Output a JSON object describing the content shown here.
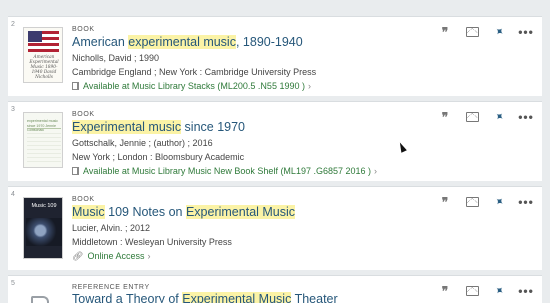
{
  "results": [
    {
      "index": "2",
      "type": "BOOK",
      "title_parts": [
        {
          "t": "American ",
          "hl": false
        },
        {
          "t": "experimental music",
          "hl": true
        },
        {
          "t": ", 1890-1940",
          "hl": false
        }
      ],
      "author_line": "Nicholls, David ; 1990",
      "publisher_line": "Cambridge England ; New York : Cambridge University Press",
      "availability_label": "Available at",
      "availability_location": "Music Library Stacks (ML200.5 .N55 1990 )",
      "cover_text": "American Experimental Music 1890-1940 David Nicholls"
    },
    {
      "index": "3",
      "type": "BOOK",
      "title_parts": [
        {
          "t": "Experimental music",
          "hl": true
        },
        {
          "t": " since 1970",
          "hl": false
        }
      ],
      "author_line": "Gottschalk, Jennie ; (author) ; 2016",
      "publisher_line": "New York ; London : Bloomsbury Academic",
      "availability_label": "Available at",
      "availability_location": "Music Library Music New Book Shelf (ML197 .G6857 2016 )",
      "cover_text": "experimental music since 1970 Jennie Gottschalk"
    },
    {
      "index": "4",
      "type": "BOOK",
      "title_parts": [
        {
          "t": "Music",
          "hl": true
        },
        {
          "t": " 109 Notes on ",
          "hl": false
        },
        {
          "t": "Experimental Music",
          "hl": true
        }
      ],
      "author_line": "Lucier, Alvin. ; 2012",
      "publisher_line": "Middletown : Wesleyan University Press",
      "online_label": "Online Access",
      "cover_text": "Music 109"
    },
    {
      "index": "5",
      "type": "REFERENCE ENTRY",
      "title_parts": [
        {
          "t": "Toward a Theory of ",
          "hl": false
        },
        {
          "t": "Experimental Music",
          "hl": true
        },
        {
          "t": " Theater",
          "hl": false
        }
      ]
    }
  ],
  "actions": {
    "cite_glyph": "❞",
    "pin_glyph": "📌",
    "more_glyph": "•••"
  },
  "colors": {
    "title": "#26577a",
    "highlight": "#fbf3a6",
    "available": "#2f7a3a",
    "pin": "#2b5f83",
    "background": "#e9ecee"
  }
}
